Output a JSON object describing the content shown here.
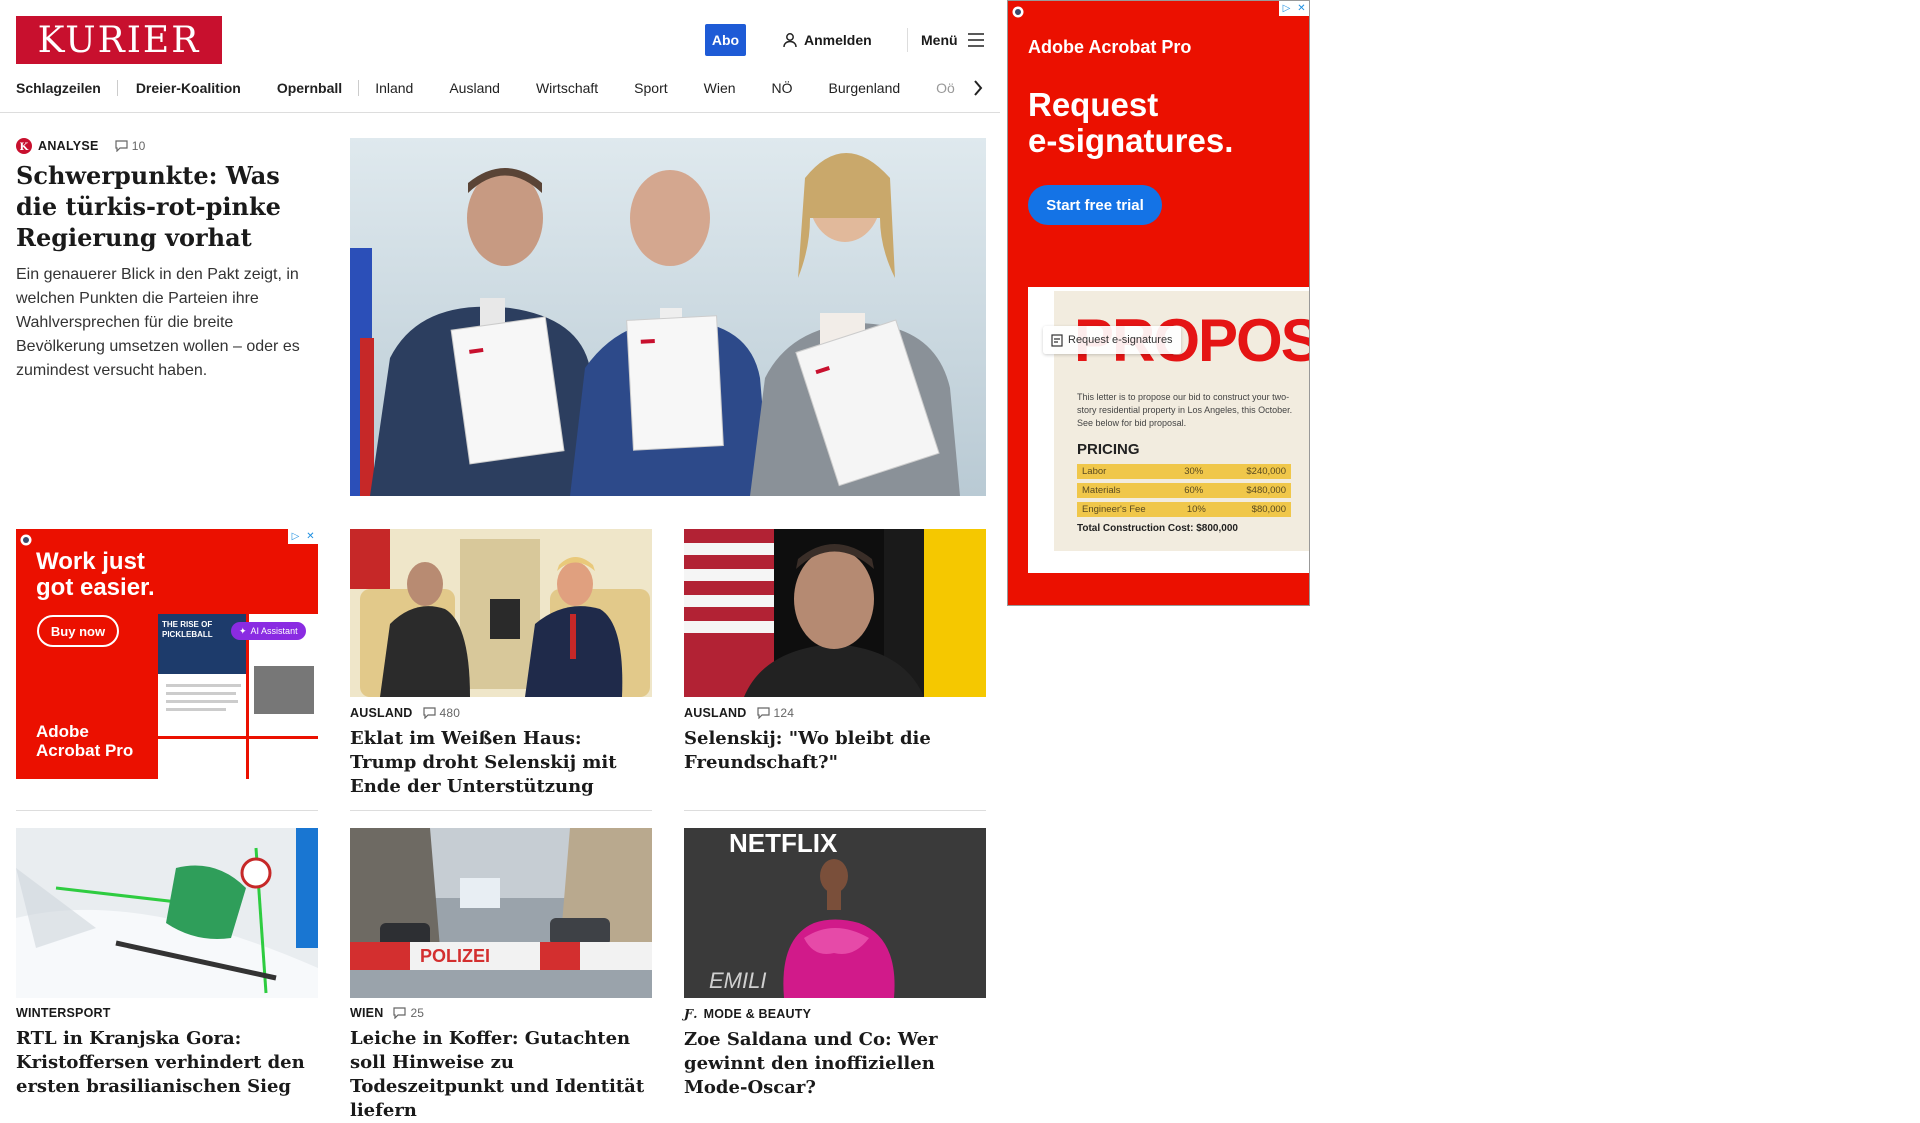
{
  "header": {
    "logo": "KURIER",
    "abo": "Abo",
    "login": "Anmelden",
    "menu": "Menü"
  },
  "nav": [
    "Schlagzeilen",
    "Dreier-Koalition",
    "Opernball",
    "Inland",
    "Ausland",
    "Wirtschaft",
    "Sport",
    "Wien",
    "NÖ",
    "Burgenland",
    "Oö"
  ],
  "lead": {
    "kicker": "ANALYSE",
    "comments": "10",
    "title": "Schwerpunkte: Was die türkis-rot-pinke Regierung vorhat",
    "teaser": "Ein genauerer Blick in den Pakt zeigt, in welchen Punkten die Parteien ihre Wahlversprechen für die breite Bevölkerung umsetzen wollen – oder es zumindest versucht haben."
  },
  "cards": [
    {
      "category": "AUSLAND",
      "comments": "480",
      "title": "Eklat im Weißen Haus: Trump droht Selenskij mit Ende der Unterstützung"
    },
    {
      "category": "AUSLAND",
      "comments": "124",
      "title": "Selenskij: \"Wo bleibt die Freundschaft?\""
    },
    {
      "category": "WINTERSPORT",
      "comments": "",
      "title": "RTL in Kranjska Gora: Kristoffersen verhindert den ersten brasilianischen Sieg"
    },
    {
      "category": "WIEN",
      "comments": "25",
      "title": "Leiche in Koffer: Gutachten soll Hinweise zu Todeszeitpunkt und Identität liefern"
    },
    {
      "category": "MODE & BEAUTY",
      "comments": "",
      "title": "Zoe Saldana und Co: Wer gewinnt den inoffiziellen Mode-Oscar?"
    }
  ],
  "image_text": {
    "polizei": "POLIZEI",
    "netflix": "NETFLIX",
    "emilia": "EMILI"
  },
  "ad_small": {
    "headline_1": "Work just",
    "headline_2": "got easier.",
    "cta": "Buy now",
    "brand_1": "Adobe",
    "brand_2": "Acrobat Pro",
    "doc_title_1": "THE RISE OF",
    "doc_title_2": "PICKLEBALL",
    "assistant": "AI Assistant"
  },
  "ad_big": {
    "brand": "Adobe Acrobat Pro",
    "headline_1": "Request",
    "headline_2": "e-signatures.",
    "cta": "Start free trial",
    "chip": "Request e-signatures",
    "doc_title": "PROPOSAL",
    "doc_text": "This letter is to propose our bid to construct your two-story residential property in Los Angeles, this October. See below for bid proposal.",
    "pricing_label": "PRICING",
    "rows": [
      {
        "item": "Labor",
        "pct": "30%",
        "amount": "$240,000"
      },
      {
        "item": "Materials",
        "pct": "60%",
        "amount": "$480,000"
      },
      {
        "item": "Engineer's Fee",
        "pct": "10%",
        "amount": "$80,000"
      }
    ],
    "total": "Total Construction Cost: $800,000"
  },
  "colors": {
    "brand_red": "#c8102e",
    "abo_blue": "#1e5bd6",
    "adobe_red": "#eb1000"
  }
}
